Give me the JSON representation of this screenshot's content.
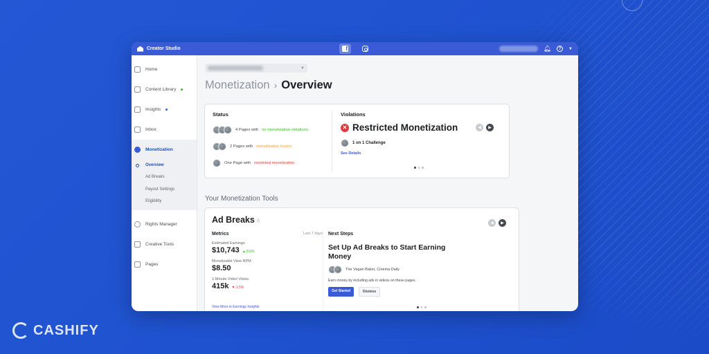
{
  "watermark": "CASHIFY",
  "topbar": {
    "app_title": "Creator Studio"
  },
  "sidebar": {
    "items": [
      {
        "label": "Home",
        "icon": "home-icon"
      },
      {
        "label": "Content Library",
        "icon": "library-icon"
      },
      {
        "label": "Insights",
        "icon": "insights-icon"
      },
      {
        "label": "Inbox",
        "icon": "inbox-icon"
      },
      {
        "label": "Monetization",
        "icon": "dollar-icon"
      },
      {
        "label": "Rights Manager",
        "icon": "copyright-icon"
      },
      {
        "label": "Creative Tools",
        "icon": "creative-tools-icon"
      },
      {
        "label": "Pages",
        "icon": "pages-icon"
      }
    ],
    "sub_items": [
      "Overview",
      "Ad Breaks",
      "Payout Settings",
      "Eligibility"
    ]
  },
  "title": {
    "section": "Monetization",
    "separator": "›",
    "page": "Overview"
  },
  "status": {
    "heading": "Status",
    "rows": [
      {
        "prefix": "4 Pages with",
        "highlight": "no monetization violations",
        "color": "#42b72a"
      },
      {
        "prefix": "2 Pages with",
        "highlight": "monetization issues",
        "color": "#e8a33d"
      },
      {
        "prefix": "One Page with",
        "highlight": "restricted monetization",
        "color": "#e0393e"
      }
    ]
  },
  "violations": {
    "heading": "Violations",
    "title": "Restricted Monetization",
    "challenge": "1 on 1 Challenge",
    "link": "See Details"
  },
  "tools": {
    "heading": "Your Monetization Tools",
    "card_title": "Ad Breaks",
    "card_badge": "6",
    "metrics_heading": "Metrics",
    "range": "Last 7 days",
    "metrics": [
      {
        "label": "Estimated Earnings",
        "value": "$10,743",
        "change": "▲ 8.5%",
        "direction": "up"
      },
      {
        "label": "Monetizable View RPM",
        "value": "$8.50",
        "change": "",
        "direction": "none"
      },
      {
        "label": "1-Minute Video Views",
        "value": "415k",
        "change": "▼ 1.5%",
        "direction": "down"
      }
    ],
    "view_more": "View More in Earnings Insights",
    "next_steps": {
      "heading": "Next Steps",
      "title": "Set Up Ad Breaks to Start Earning Money",
      "pages": "The Vegan Baker, Cinema Daily",
      "description": "Earn money by including ads in videos on these pages.",
      "primary_button": "Get Started",
      "secondary_button": "Dismiss"
    }
  }
}
